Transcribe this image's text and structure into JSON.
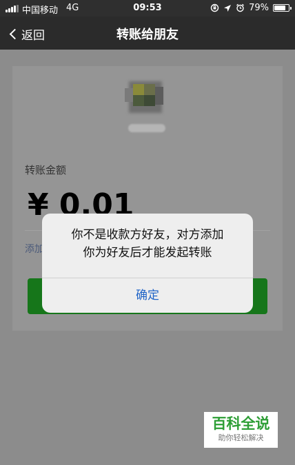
{
  "status_bar": {
    "carrier": "中国移动",
    "network": "4G",
    "time": "09:53",
    "battery": "79%",
    "battery_level": 0.79,
    "icons": [
      "signal-icon",
      "orientation-lock-icon",
      "location-icon",
      "alarm-icon",
      "battery-icon"
    ]
  },
  "nav": {
    "back_label": "返回",
    "title": "转账给朋友"
  },
  "transfer": {
    "amount_label": "转账金额",
    "amount": "¥ 0.01",
    "note_link": "添加"
  },
  "dialog": {
    "message_line1": "你不是收款方好友，对方添加",
    "message_line2": "你为好友后才能发起转账",
    "confirm_label": "确定"
  },
  "watermark": {
    "title": "百科全说",
    "subtitle": "助你轻松解决"
  },
  "colors": {
    "nav_bg": "#2b2b2b",
    "button_green": "#16761a",
    "link_blue": "#1e63c7",
    "watermark_green": "#2d9e35"
  }
}
